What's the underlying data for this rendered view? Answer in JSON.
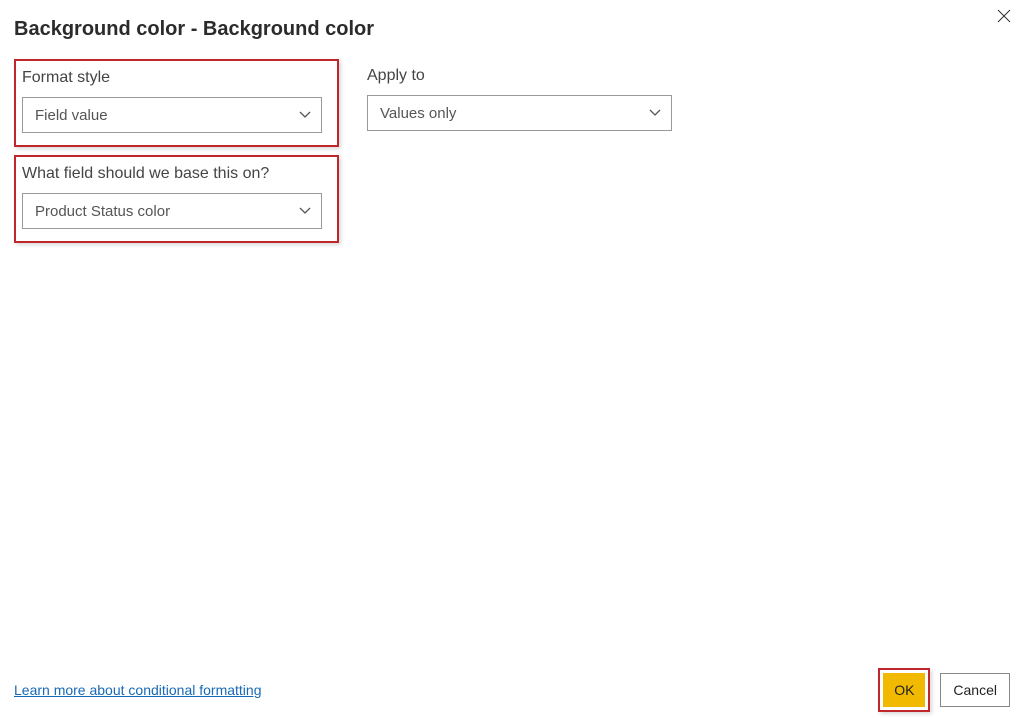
{
  "dialog": {
    "title": "Background color - Background color"
  },
  "formatStyle": {
    "label": "Format style",
    "value": "Field value"
  },
  "applyTo": {
    "label": "Apply to",
    "value": "Values only"
  },
  "baseField": {
    "label": "What field should we base this on?",
    "value": "Product Status color"
  },
  "footer": {
    "learnLink": "Learn more about conditional formatting",
    "ok": "OK",
    "cancel": "Cancel"
  }
}
